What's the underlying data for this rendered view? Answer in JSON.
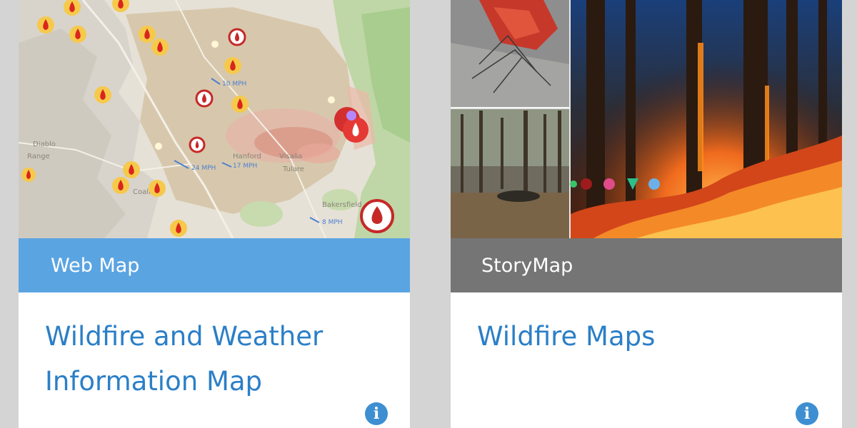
{
  "cards": [
    {
      "type_label": "Web Map",
      "title": "Wildfire and Weather Information Map",
      "thumbnail": {
        "kind": "map",
        "place_labels": [
          "Diablo",
          "Range",
          "Coalinga",
          "Hanford",
          "Visalia",
          "Tulare",
          "Bakersfield"
        ],
        "wind_labels": [
          "10 MPH",
          "24 MPH",
          "17 MPH",
          "8 MPH"
        ]
      },
      "info_icon": "info-icon"
    },
    {
      "type_label": "StoryMap",
      "title": "Wildfire Maps",
      "thumbnail": {
        "kind": "photo-collage"
      },
      "info_icon": "info-icon"
    }
  ],
  "colors": {
    "webmap_bar": "#5ba4e2",
    "storymap_bar": "#757575",
    "title_link": "#2b7fc7",
    "page_background": "#d4d4d4"
  }
}
